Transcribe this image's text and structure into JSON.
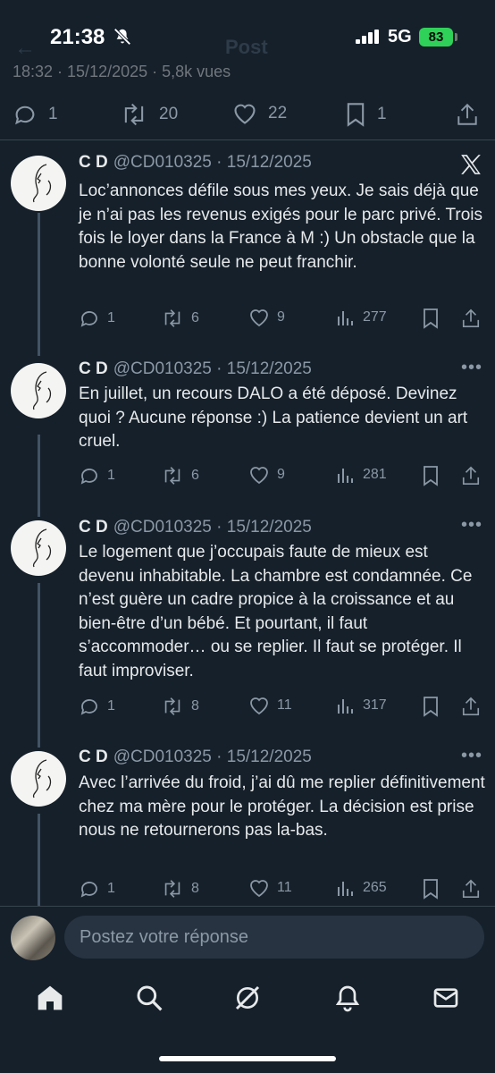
{
  "status_bar": {
    "time": "21:38",
    "network": "5G",
    "battery": "83",
    "bell_icon": "bell-slash-icon"
  },
  "header": {
    "title": "Post",
    "back_icon": "arrow-left-icon"
  },
  "main_post": {
    "meta": "18:32 · 15/12/2025 · 5,8k vues",
    "replies": "1",
    "reposts": "20",
    "likes": "22",
    "bookmarks": "1"
  },
  "replies": [
    {
      "name": "C D",
      "handle": "@CD010325",
      "date": "· 15/12/2025",
      "text": "Loc’annonces défile sous mes yeux. Je sais déjà que je n’ai pas les revenus exigés pour le parc privé. Trois fois le loyer dans la France à M :) Un obstacle que la bonne volonté seule ne peut franchir.",
      "replies": "1",
      "reposts": "6",
      "likes": "9",
      "views": "277"
    },
    {
      "name": "C D",
      "handle": "@CD010325",
      "date": "· 15/12/2025",
      "text": "En juillet, un recours DALO a été déposé. Devinez quoi ? Aucune réponse :) La patience devient un art cruel.",
      "replies": "1",
      "reposts": "6",
      "likes": "9",
      "views": "281"
    },
    {
      "name": "C D",
      "handle": "@CD010325",
      "date": "· 15/12/2025",
      "text": "Le logement que j’occupais faute de mieux est devenu inhabitable. La chambre est condamnée. Ce n’est guère un cadre propice à la croissance et au bien-être d’un bébé. Et pourtant, il faut s’accommoder… ou se replier. Il faut se protéger. Il faut improviser.",
      "replies": "1",
      "reposts": "8",
      "likes": "11",
      "views": "317"
    },
    {
      "name": "C D",
      "handle": "@CD010325",
      "date": "· 15/12/2025",
      "text": "Avec l’arrivée du froid, j’ai dû me replier définitivement chez ma mère pour le protéger. La décision est prise nous ne retournerons pas la-bas.",
      "replies": "1",
      "reposts": "8",
      "likes": "11",
      "views": "265"
    }
  ],
  "composer": {
    "placeholder": "Postez votre réponse"
  },
  "tabbar": {
    "items": [
      "home-icon",
      "search-icon",
      "grok-icon",
      "notifications-icon",
      "messages-icon"
    ]
  },
  "colors": {
    "background": "#15202b",
    "text": "#e7e9ea",
    "muted": "#8b98a5",
    "battery": "#30d158"
  }
}
